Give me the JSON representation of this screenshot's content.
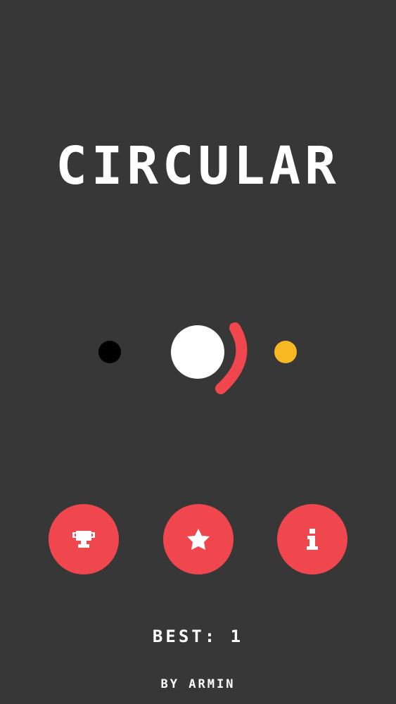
{
  "game": {
    "title": "CIRCULAR",
    "best_label": "BEST:",
    "best_value": "1",
    "credit": "BY ARMIN"
  },
  "buttons": [
    {
      "name": "leaderboard",
      "icon": "trophy-icon"
    },
    {
      "name": "rate",
      "icon": "star-icon"
    },
    {
      "name": "info",
      "icon": "info-icon"
    }
  ],
  "colors": {
    "background": "#383738",
    "accent": "#f0474e",
    "player": "#ffffff",
    "enemy_dot": "#000000",
    "bonus_dot": "#f8b823"
  }
}
